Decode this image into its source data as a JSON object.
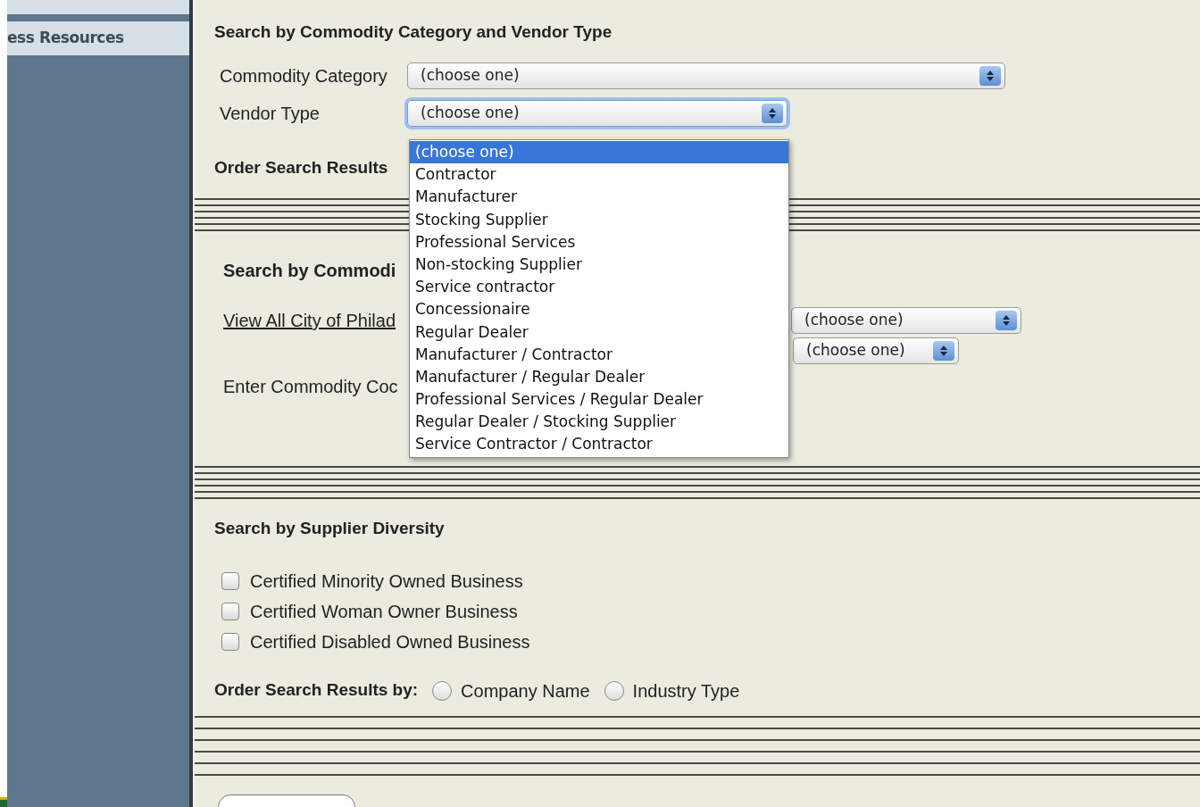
{
  "sidebar": {
    "items": [
      {
        "kind": "blank"
      },
      {
        "kind": "text",
        "label": "ess Resources"
      }
    ]
  },
  "section_1": {
    "title": "Search by Commodity Category and Vendor Type",
    "fields": [
      {
        "label": "Commodity Category",
        "value": "(choose one)",
        "open": false
      },
      {
        "label": "Vendor Type",
        "value": "(choose one)",
        "open": true
      }
    ],
    "order_label": "Order Search Results"
  },
  "vendor_type_options": [
    {
      "label": "(choose one)",
      "selected": true
    },
    {
      "label": "Contractor",
      "selected": false
    },
    {
      "label": "Manufacturer",
      "selected": false
    },
    {
      "label": "Stocking Supplier",
      "selected": false
    },
    {
      "label": "Professional Services",
      "selected": false
    },
    {
      "label": "Non-stocking Supplier",
      "selected": false
    },
    {
      "label": "Service contractor",
      "selected": false
    },
    {
      "label": "Concessionaire",
      "selected": false
    },
    {
      "label": "Regular Dealer",
      "selected": false
    },
    {
      "label": "Manufacturer / Contractor",
      "selected": false
    },
    {
      "label": "Manufacturer / Regular Dealer",
      "selected": false
    },
    {
      "label": "Professional Services / Regular Dealer",
      "selected": false
    },
    {
      "label": "Regular Dealer / Stocking Supplier",
      "selected": false
    },
    {
      "label": "Service Contractor / Contractor",
      "selected": false
    }
  ],
  "section_2": {
    "title": "Search by Commodi",
    "link": "View All City of Philad",
    "link_select": "(choose one)",
    "code_label": "Enter Commodity Coc",
    "code_select": "(choose one)"
  },
  "section_3": {
    "title": "Search by Supplier Diversity",
    "checkboxes": [
      {
        "label": "Certified Minority Owned Business",
        "checked": false
      },
      {
        "label": "Certified Woman Owner Business",
        "checked": false
      },
      {
        "label": "Certified Disabled Owned Business",
        "checked": false
      }
    ],
    "order_label": "Order Search Results by:",
    "order_options": [
      {
        "label": "Company Name",
        "selected": false
      },
      {
        "label": "Industry Type",
        "selected": false
      }
    ]
  }
}
